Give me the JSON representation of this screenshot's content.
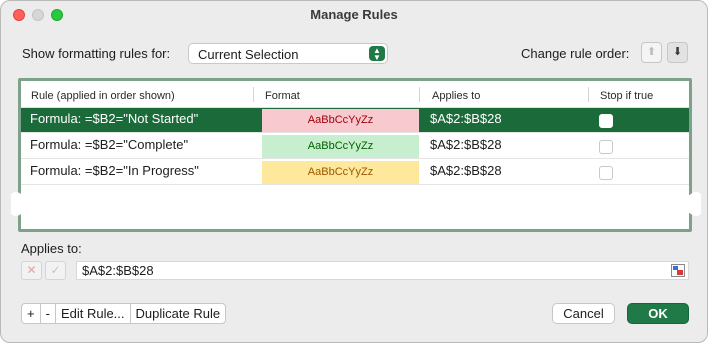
{
  "window": {
    "title": "Manage Rules"
  },
  "show_rules": {
    "label": "Show formatting rules for:",
    "value": "Current Selection"
  },
  "change_order": {
    "label": "Change rule order:"
  },
  "table": {
    "headers": [
      "Rule (applied in order shown)",
      "Format",
      "Applies to",
      "Stop if true"
    ],
    "rows": [
      {
        "rule": "Formula: =$B2=\"Not Started\"",
        "format_preview": "AaBbCcYyZz",
        "format_bg": "#f8c9cf",
        "format_color": "#9c0006",
        "applies_to": "$A$2:$B$28",
        "selected": true
      },
      {
        "rule": "Formula: =$B2=\"Complete\"",
        "format_preview": "AaBbCcYyZz",
        "format_bg": "#c7efcf",
        "format_color": "#006100",
        "applies_to": "$A$2:$B$28",
        "selected": false
      },
      {
        "rule": "Formula: =$B2=\"In Progress\"",
        "format_preview": "AaBbCcYyZz",
        "format_bg": "#fde89b",
        "format_color": "#9c5700",
        "applies_to": "$A$2:$B$28",
        "selected": false
      }
    ]
  },
  "applies": {
    "label": "Applies to:",
    "value": "$A$2:$B$28"
  },
  "buttons": {
    "add": "+",
    "remove": "-",
    "edit": "Edit Rule...",
    "duplicate": "Duplicate Rule",
    "cancel": "Cancel",
    "ok": "OK"
  },
  "colors": {
    "accent": "#1f7a47",
    "selected_row": "#1b6b3a"
  },
  "icons": [
    "chevron-updown-icon",
    "arrow-up-icon",
    "arrow-down-icon",
    "close-icon",
    "checkmark-icon",
    "range-select-icon"
  ]
}
